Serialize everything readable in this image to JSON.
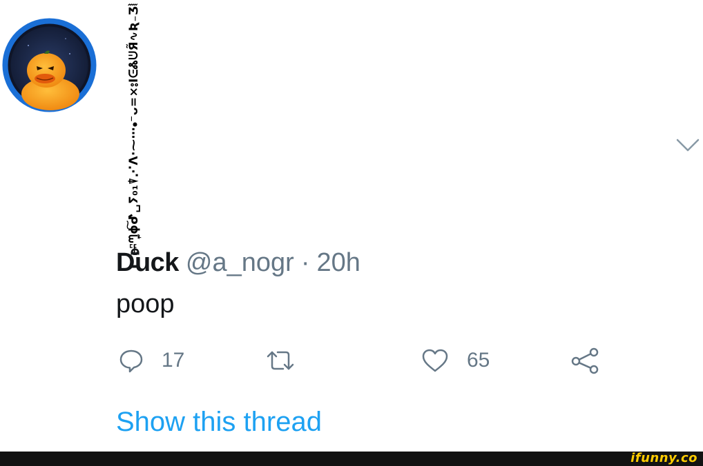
{
  "tweet": {
    "display_name": "D̵͒̈uck",
    "decorated_name": "ʭ̶ᘉ͎̫ɸ͠ᕷ␣ⵢ₀₁⍒⋰ⴷ·⁓⋯⦁⁻ᴗ=⨯⦂ΙᕮᏜᕫЯ̃∿Ʀ₋Ʒ⦚⋮",
    "handle": "@a_nogr",
    "separator": "·",
    "time": "20h",
    "text": "poop",
    "reply_count": "17",
    "like_count": "65",
    "show_thread": "Show this thread"
  },
  "icons": {
    "avatar": "pumpkin-duck-avatar",
    "caret": "chevron-down-icon",
    "reply": "comment-icon",
    "retweet": "retweet-icon",
    "like": "heart-icon",
    "share": "share-icon"
  },
  "colors": {
    "accent": "#1da1f2",
    "secondary_text": "#657786",
    "primary_text": "#14171a",
    "avatar_ring": "#1a6fd6",
    "avatar_bg": "#1b2a4a",
    "watermark": "#ffcc00"
  },
  "watermark": "ifunny.co"
}
